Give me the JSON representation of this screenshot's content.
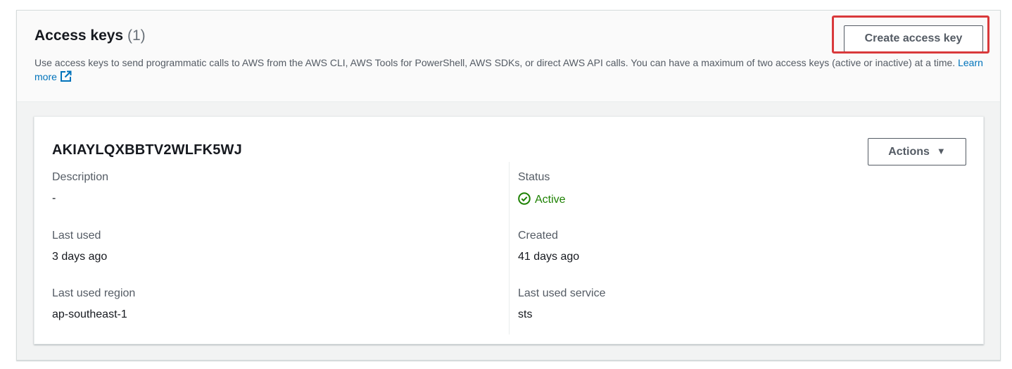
{
  "header": {
    "title": "Access keys",
    "count": "(1)",
    "description": "Use access keys to send programmatic calls to AWS from the AWS CLI, AWS Tools for PowerShell, AWS SDKs, or direct AWS API calls. You can have a maximum of two access keys (active or inactive) at a time.",
    "learn_more": "Learn more",
    "create_button": "Create access key"
  },
  "key": {
    "id": "AKIAYLQXBBTV2WLFK5WJ",
    "actions_label": "Actions",
    "description_label": "Description",
    "description_value": "-",
    "last_used_label": "Last used",
    "last_used_value": "3 days ago",
    "last_used_region_label": "Last used region",
    "last_used_region_value": "ap-southeast-1",
    "status_label": "Status",
    "status_value": "Active",
    "created_label": "Created",
    "created_value": "41 days ago",
    "last_used_service_label": "Last used service",
    "last_used_service_value": "sts"
  },
  "colors": {
    "link": "#0073bb",
    "active": "#1d8102",
    "highlight": "#d9393b"
  },
  "icons": {
    "external": "external-link-icon",
    "status": "check-circle-icon",
    "caret": "caret-down-icon"
  }
}
